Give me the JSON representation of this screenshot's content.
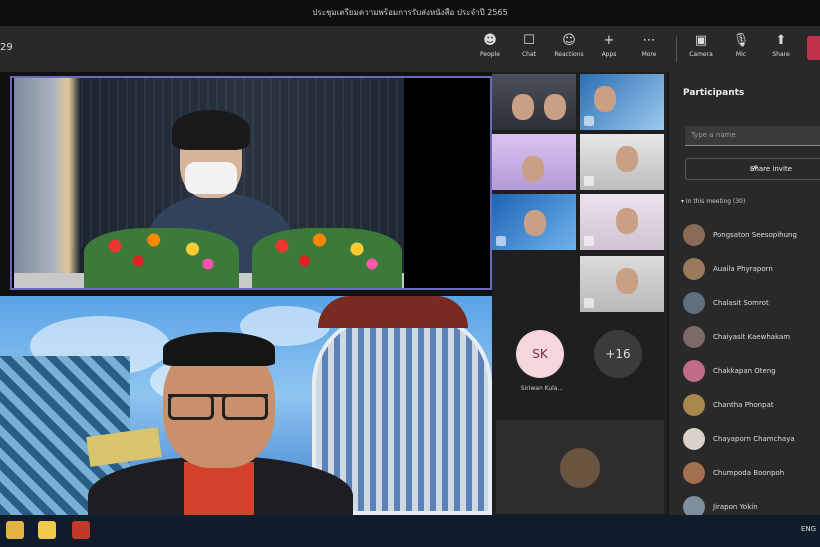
{
  "window": {
    "title": "ประชุมเตรียมความพร้อมการรับส่งหนังสือ ประจำปี 2565"
  },
  "meeting": {
    "timer": "29"
  },
  "toolbar": {
    "items": [
      {
        "label": "People",
        "icon": "people-icon"
      },
      {
        "label": "Chat",
        "icon": "chat-icon"
      },
      {
        "label": "Reactions",
        "icon": "reactions-icon"
      },
      {
        "label": "Apps",
        "icon": "apps-icon"
      },
      {
        "label": "More",
        "icon": "more-icon"
      },
      {
        "label": "Camera",
        "icon": "camera-icon"
      },
      {
        "label": "Mic",
        "icon": "mic-icon"
      },
      {
        "label": "Share",
        "icon": "share-icon"
      }
    ]
  },
  "grid": {
    "avatars": [
      {
        "initials": "SK",
        "name": "Siriwan Kula...",
        "bg": "#f6d5dc",
        "fg": "#7a2e43"
      },
      {
        "initials": "+16",
        "name": "",
        "bg": "#3b3b3b",
        "fg": "#dddddd"
      }
    ]
  },
  "panel": {
    "title": "Participants",
    "search_placeholder": "Type a name",
    "share_invite": "Share invite",
    "section": "In this meeting (30)",
    "participants": [
      {
        "name": "Pongsaton Seesopihung",
        "color": "#8a6b55"
      },
      {
        "name": "Auaila Phyraporn",
        "color": "#9b7a5c"
      },
      {
        "name": "Chalasit Somrot",
        "color": "#5f6f7c"
      },
      {
        "name": "Chaiyasit Kaewhakam",
        "color": "#7c6a66"
      },
      {
        "name": "Chakkapan Oteng",
        "color": "#c06b8a"
      },
      {
        "name": "Chantha Phonpat",
        "color": "#a8884d"
      },
      {
        "name": "Chayaporn Chamchaya",
        "color": "#d9d2c8"
      },
      {
        "name": "Chumpoda Boonpoh",
        "color": "#a07050"
      },
      {
        "name": "Jirapon Yokin",
        "color": "#7f8fa0"
      }
    ]
  },
  "taskbar": {
    "tray": "ENG"
  }
}
